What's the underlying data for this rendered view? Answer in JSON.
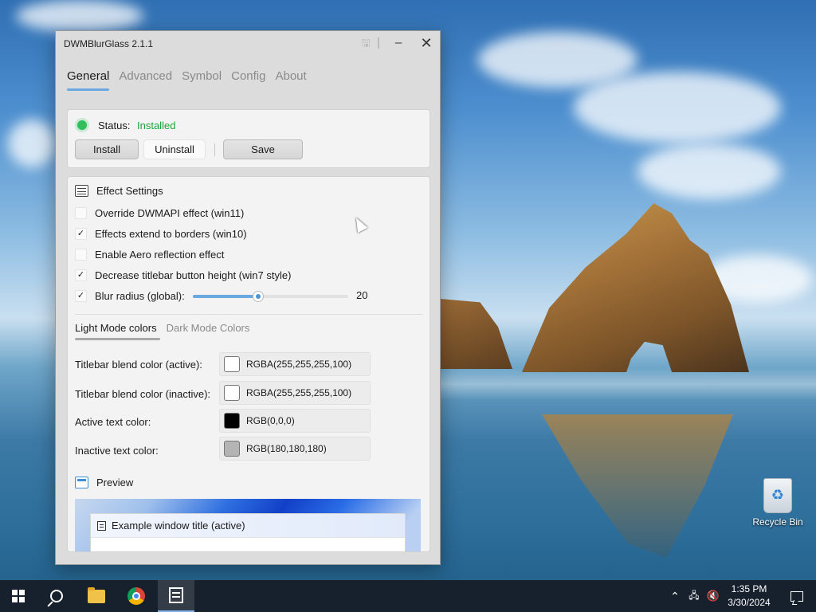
{
  "window": {
    "title": "DWMBlurGlass 2.1.1",
    "controls": {
      "minimize": "–",
      "close": "✕"
    }
  },
  "tabs": [
    {
      "label": "General",
      "active": true
    },
    {
      "label": "Advanced",
      "active": false
    },
    {
      "label": "Symbol",
      "active": false
    },
    {
      "label": "Config",
      "active": false
    },
    {
      "label": "About",
      "active": false
    }
  ],
  "status": {
    "label": "Status:",
    "value": "Installed",
    "value_color": "#17a83a",
    "install_label": "Install",
    "uninstall_label": "Uninstall",
    "save_label": "Save"
  },
  "effect_settings": {
    "heading": "Effect Settings",
    "options": [
      {
        "label": "Override DWMAPI effect (win11)",
        "checked": false
      },
      {
        "label": "Effects extend to borders (win10)",
        "checked": true
      },
      {
        "label": "Enable Aero reflection effect",
        "checked": false
      },
      {
        "label": "Decrease titlebar button height (win7 style)",
        "checked": true
      },
      {
        "label": "Blur radius (global):",
        "checked": true
      }
    ],
    "blur_radius_value": "20",
    "blur_radius_fraction": 0.42
  },
  "color_tabs": [
    {
      "label": "Light Mode colors",
      "active": true
    },
    {
      "label": "Dark Mode Colors",
      "active": false
    }
  ],
  "colors": [
    {
      "label": "Titlebar blend color (active):",
      "value": "RGBA(255,255,255,100)",
      "swatch": "#ffffff"
    },
    {
      "label": "Titlebar blend color (inactive):",
      "value": "RGBA(255,255,255,100)",
      "swatch": "#ffffff"
    },
    {
      "label": "Active text color:",
      "value": "RGB(0,0,0)",
      "swatch": "#000000"
    },
    {
      "label": "Inactive text color:",
      "value": "RGB(180,180,180)",
      "swatch": "#b4b4b4"
    }
  ],
  "preview": {
    "heading": "Preview",
    "window_title": "Example window title (active)"
  },
  "desktop": {
    "recycle_bin_label": "Recycle Bin"
  },
  "taskbar": {
    "time": "1:35 PM",
    "date": "3/30/2024",
    "accent": "#7fb0e6"
  }
}
